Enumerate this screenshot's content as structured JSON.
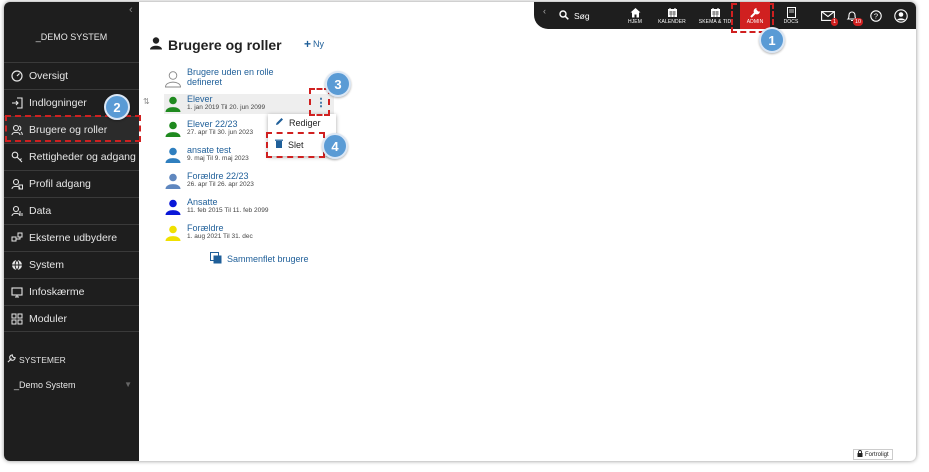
{
  "sidebar": {
    "brand": "_DEMO SYSTEM",
    "items": [
      {
        "label": "Oversigt",
        "icon": "dashboard-icon"
      },
      {
        "label": "Indlogninger",
        "icon": "login-icon"
      },
      {
        "label": "Brugere og roller",
        "icon": "users-icon"
      },
      {
        "label": "Rettigheder og adgang",
        "icon": "key-icon"
      },
      {
        "label": "Profil adgang",
        "icon": "profile-access-icon"
      },
      {
        "label": "Data",
        "icon": "data-icon"
      },
      {
        "label": "Eksterne udbydere",
        "icon": "external-providers-icon"
      },
      {
        "label": "System",
        "icon": "globe-icon"
      },
      {
        "label": "Infoskærme",
        "icon": "monitor-icon"
      },
      {
        "label": "Moduler",
        "icon": "modules-icon"
      }
    ],
    "systems_title": "SYSTEMER",
    "system_item": "_Demo System"
  },
  "topbar": {
    "search_label": "Søg",
    "hjem": "HJEM",
    "kalender": "KALENDER",
    "skema": "SKEMA & TID",
    "admin": "ADMIN",
    "docs": "DOCS",
    "mail_count": "1",
    "notif_count": "10"
  },
  "page": {
    "title": "Brugere og roller",
    "new_label": "Ny",
    "merge_label": "Sammenflet brugere",
    "confidential": "Fortroligt"
  },
  "roles": [
    {
      "name": "Brugere uden en rolle defineret",
      "dates": "",
      "color": "#ffffff"
    },
    {
      "name": "Elever",
      "dates": "1. jan 2019 Til 20. jun 2099",
      "color": "#1f8a1f"
    },
    {
      "name": "Elever 22/23",
      "dates": "27. apr Til 30. jun 2023",
      "color": "#1f8a1f"
    },
    {
      "name": "ansate test",
      "dates": "9. maj Til 9. maj 2023",
      "color": "#2f7fbf"
    },
    {
      "name": "Forældre 22/23",
      "dates": "26. apr Til 26. apr 2023",
      "color": "#5f87bf"
    },
    {
      "name": "Ansatte",
      "dates": "11. feb 2015 Til 11. feb 2099",
      "color": "#0a18d8"
    },
    {
      "name": "Forældre",
      "dates": "1. aug 2021 Til 31. dec",
      "color": "#f0e000"
    }
  ],
  "context_menu": {
    "edit": "Rediger",
    "delete": "Slet"
  },
  "steps": [
    "1",
    "2",
    "3",
    "4"
  ],
  "colors": {
    "accent": "#1f5f99",
    "highlight": "#d02020",
    "step_badge": "#5a9bd5",
    "sidebar_bg": "#1e1e1e"
  }
}
